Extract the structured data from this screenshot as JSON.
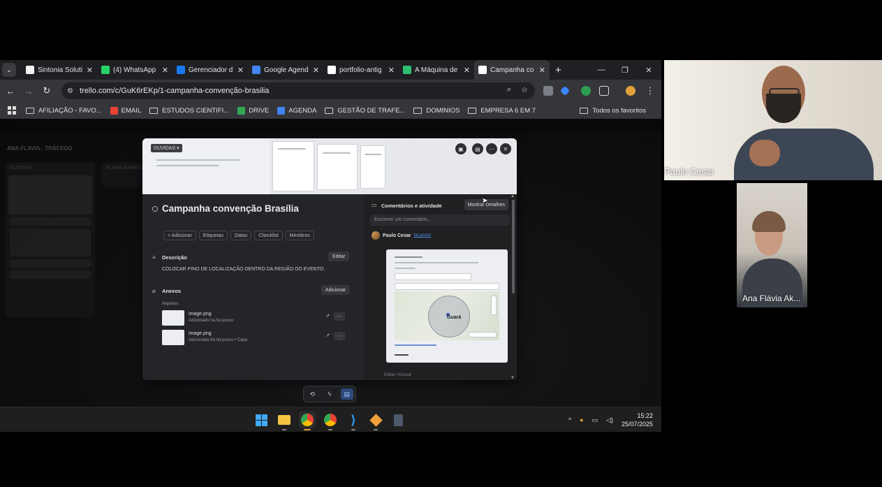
{
  "browser": {
    "tabs": [
      {
        "title": "Sintonia Soluti",
        "icon": "sintonia-icon",
        "color": "#f2f2f2"
      },
      {
        "title": "(4) WhatsApp",
        "icon": "whatsapp-icon",
        "color": "#25d366"
      },
      {
        "title": "Gerenciador d",
        "icon": "meta-icon",
        "color": "#1877f2"
      },
      {
        "title": "Google Agend",
        "icon": "google-calendar-icon",
        "color": "#4285f4"
      },
      {
        "title": "portfolio-antig",
        "icon": "github-icon",
        "color": "#ffffff"
      },
      {
        "title": "A Máquina de",
        "icon": "maquina-icon",
        "color": "#2fbf71"
      },
      {
        "title": "Campanha co",
        "icon": "trello-icon",
        "color": "#ffffff",
        "active": true
      }
    ],
    "url": "trello.com/c/GuK6rEKp/1-campanha-convenção-brasilia",
    "bookmarks": [
      {
        "label": "AFILIAÇÃO - FAVO...",
        "icon": "folder-icon"
      },
      {
        "label": "EMAIL",
        "icon": "gmail-icon"
      },
      {
        "label": "ESTUDOS CIENTIFI...",
        "icon": "folder-icon"
      },
      {
        "label": "DRIVE",
        "icon": "drive-icon"
      },
      {
        "label": "AGENDA",
        "icon": "calendar-icon"
      },
      {
        "label": "GESTÃO DE TRAFE...",
        "icon": "folder-icon"
      },
      {
        "label": "DOMINIOS",
        "icon": "folder-icon"
      },
      {
        "label": "EMPRESA 6 EM 7",
        "icon": "folder-icon"
      }
    ],
    "all_bookmarks": "Todos os favoritos"
  },
  "board": {
    "name": "ANA FLAVIA - TRÁFEGO",
    "lists": [
      "DUVIDAS",
      "PLANEJAMENTO"
    ]
  },
  "card": {
    "cover_badge": "DUVIDAS",
    "title": "Campanha convenção Brasília",
    "actions": [
      "+ Adicionar",
      "Etiquetas",
      "Datas",
      "Checklist",
      "Membros"
    ],
    "description": {
      "title": "Descrição",
      "edit_label": "Editar",
      "text": "COLOCAR PINO DE LOCALIZAÇÃO DENTRO DA REGIÃO DO EVENTO."
    },
    "attachments": {
      "title": "Anexos",
      "add_label": "Adicionar",
      "subtitle": "Arquivos",
      "items": [
        {
          "name": "image.png",
          "meta": "Adicionado há há pouco"
        },
        {
          "name": "image.png",
          "meta": "Adicionado há há pouco • Capa"
        }
      ]
    },
    "activity": {
      "title": "Comentários e atividade",
      "toggle_label": "Mostrar Detalhes",
      "comment_placeholder": "Escrever um comentário...",
      "author": "Paulo Cesar",
      "time": "há pouco",
      "map_label": "Guará",
      "footer": "Editar • Excluir"
    }
  },
  "taskbar": {
    "time": "15:22",
    "date": "25/07/2025"
  },
  "participants": [
    {
      "name": "Paulo Cesar"
    },
    {
      "name": "Ana Flávia Ak..."
    }
  ]
}
